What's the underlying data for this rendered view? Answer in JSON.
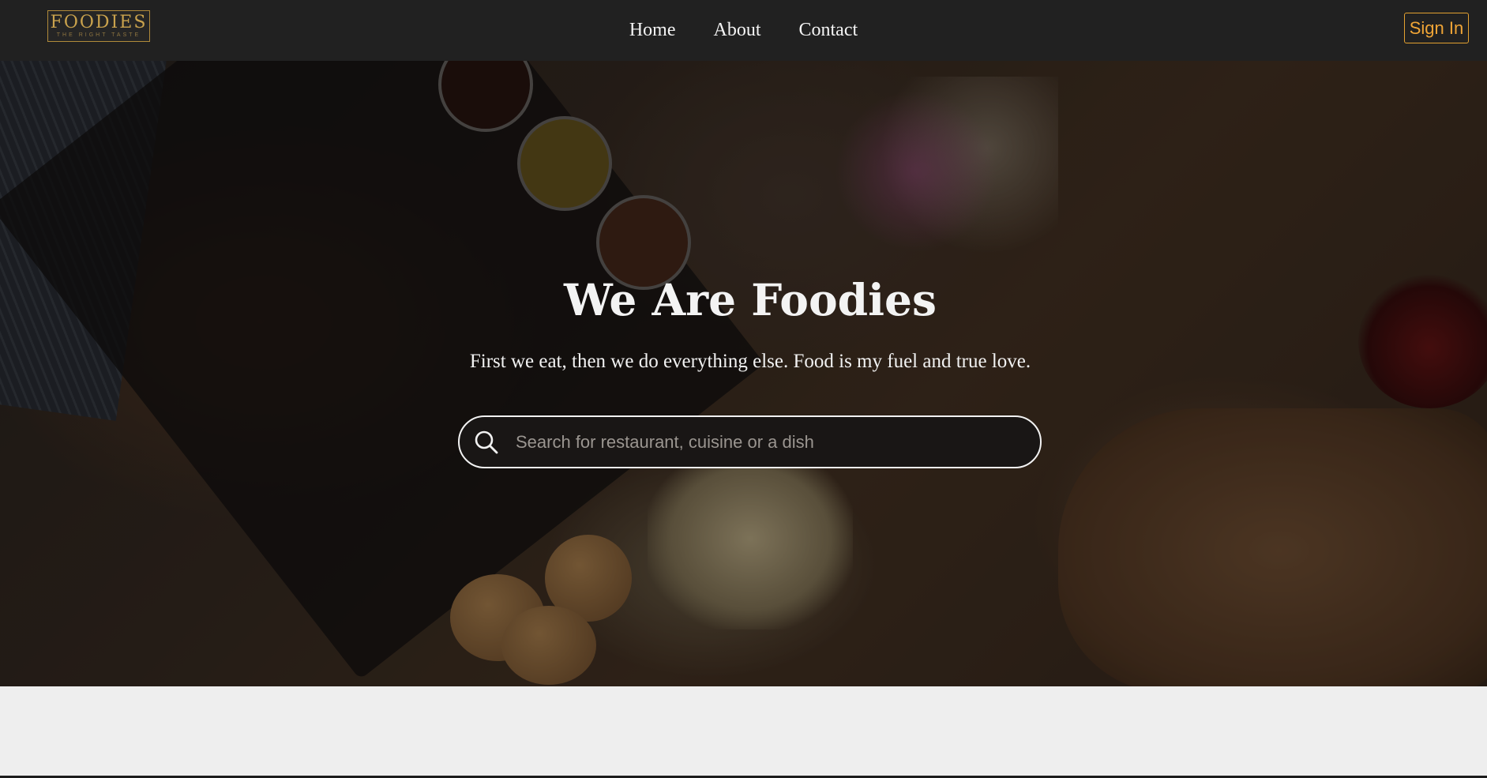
{
  "navbar": {
    "logo": {
      "title": "FOODIES",
      "tagline": "THE RIGHT TASTE"
    },
    "links": [
      {
        "label": "Home"
      },
      {
        "label": "About"
      },
      {
        "label": "Contact"
      }
    ],
    "signin_label": "Sign In",
    "accent_color": "#f0a536"
  },
  "hero": {
    "title": "We Are Foodies",
    "subtitle": "First we eat, then we do everything else. Food is my fuel and true love.",
    "search": {
      "placeholder": "Search for restaurant, cuisine or a dish",
      "value": "",
      "icon": "search-icon"
    }
  }
}
